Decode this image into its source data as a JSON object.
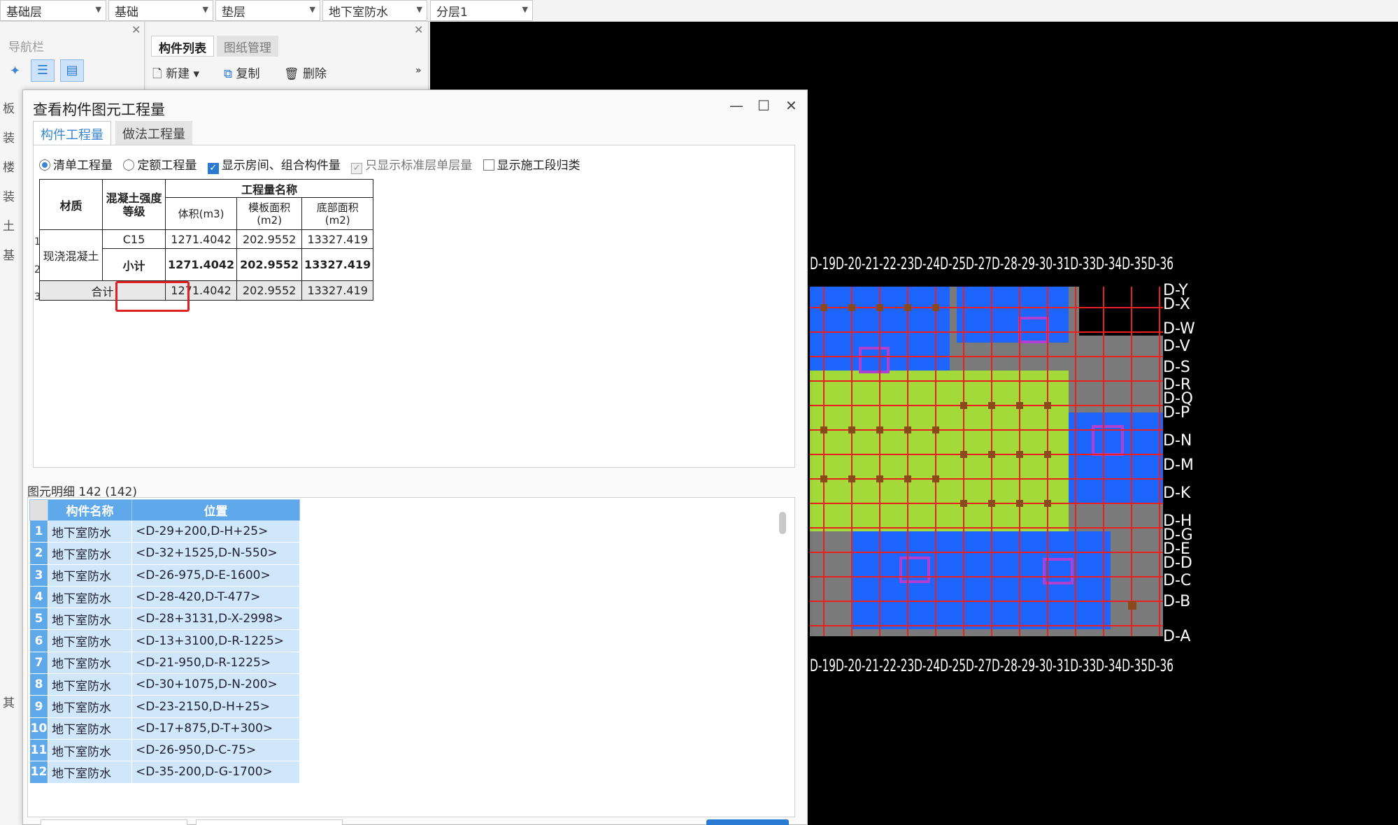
{
  "toolbar": {
    "combos": [
      "基础层",
      "基础",
      "垫层",
      "地下室防水",
      "分层1"
    ]
  },
  "nav": {
    "title": "导航栏",
    "side_letters": [
      "板",
      "装",
      "楼",
      "装",
      "土",
      "基",
      "其"
    ]
  },
  "component_panel": {
    "tabs": [
      "构件列表",
      "图纸管理"
    ],
    "new_label": "新建",
    "copy_label": "复制",
    "delete_label": "删除"
  },
  "dialog": {
    "title": "查看构件图元工程量",
    "tabs": [
      "构件工程量",
      "做法工程量"
    ],
    "options": {
      "bill_qty": "清单工程量",
      "quota_qty": "定额工程量",
      "show_rooms": "显示房间、组合构件量",
      "std_layer_only": "只显示标准层单层量",
      "show_stage": "显示施工段归类"
    },
    "qty_table": {
      "h_material": "材质",
      "h_grade": "混凝土强度等级",
      "h_group": "工程量名称",
      "h_volume": "体积(m3)",
      "h_formwork": "模板面积(m2)",
      "h_bottom": "底部面积(m2)",
      "material": "现浇混凝土",
      "r1_grade": "C15",
      "r1_volume": "1271.4042",
      "r1_formwork": "202.9552",
      "r1_bottom": "13327.419",
      "r2_grade": "小计",
      "r2_volume": "1271.4042",
      "r2_formwork": "202.9552",
      "r2_bottom": "13327.419",
      "r3_label": "合计",
      "r3_volume": "1271.4042",
      "r3_formwork": "202.9552",
      "r3_bottom": "13327.419",
      "row_nums": [
        "1",
        "2",
        "3"
      ]
    },
    "detail": {
      "header": "图元明细  142 (142)",
      "col_name": "构件名称",
      "col_pos": "位置",
      "rows": [
        {
          "n": "1",
          "name": "地下室防水",
          "pos": "<D-29+200,D-H+25>"
        },
        {
          "n": "2",
          "name": "地下室防水",
          "pos": "<D-32+1525,D-N-550>"
        },
        {
          "n": "3",
          "name": "地下室防水",
          "pos": "<D-26-975,D-E-1600>"
        },
        {
          "n": "4",
          "name": "地下室防水",
          "pos": "<D-28-420,D-T-477>"
        },
        {
          "n": "5",
          "name": "地下室防水",
          "pos": "<D-28+3131,D-X-2998>"
        },
        {
          "n": "6",
          "name": "地下室防水",
          "pos": "<D-13+3100,D-R-1225>"
        },
        {
          "n": "7",
          "name": "地下室防水",
          "pos": "<D-21-950,D-R-1225>"
        },
        {
          "n": "8",
          "name": "地下室防水",
          "pos": "<D-30+1075,D-N-200>"
        },
        {
          "n": "9",
          "name": "地下室防水",
          "pos": "<D-23-2150,D-H+25>"
        },
        {
          "n": "10",
          "name": "地下室防水",
          "pos": "<D-17+875,D-T+300>"
        },
        {
          "n": "11",
          "name": "地下室防水",
          "pos": "<D-26-950,D-C-75>"
        },
        {
          "n": "12",
          "name": "地下室防水",
          "pos": "<D-35-200,D-G-1700>"
        }
      ]
    }
  },
  "cad": {
    "axis_labels_right": [
      "D-Y",
      "D-X",
      "D-W",
      "D-V",
      "D-S",
      "D-R",
      "D-Q",
      "D-P",
      "D-N",
      "D-M",
      "D-K",
      "D-H",
      "D-G",
      "D-E",
      "D-D",
      "D-C",
      "D-B",
      "D-A"
    ],
    "top_label": "D-19D-20-21-22-23D-24D-25D-27D-28-29-30-31D-33D-34D-35D-36",
    "bottom_label": "D-19D-20-21-22-23D-24D-25D-27D-28-29-30-31D-33D-34D-35D-36",
    "colors": {
      "green": "#a4d93a",
      "blue": "#1e64ff",
      "gray": "#7a7a7a",
      "red": "#e82020",
      "magenta": "#b040d0",
      "yellow": "#e8e070",
      "brown": "#8a4a1a"
    }
  }
}
